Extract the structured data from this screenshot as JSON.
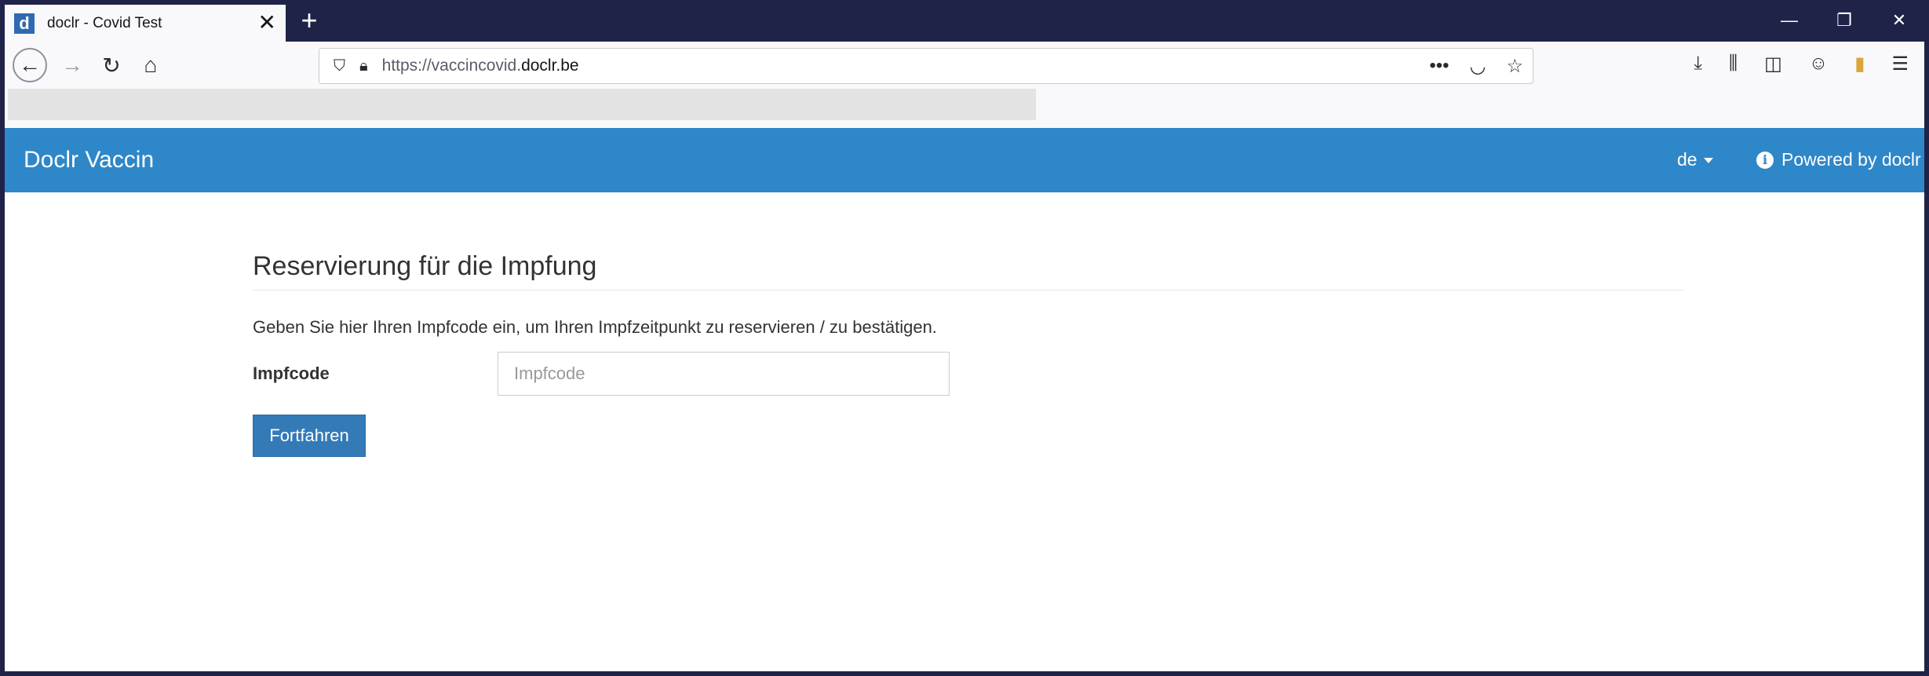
{
  "browser": {
    "tab_title": "doclr - Covid Test",
    "favicon_letter": "d",
    "url_prefix": "https://vaccincovid.",
    "url_domain": "doclr.be"
  },
  "site": {
    "brand": "Doclr Vaccin",
    "language": "de",
    "powered_by": "Powered by doclr",
    "accent_color": "#2e87c8"
  },
  "form": {
    "heading": "Reservierung für die Impfung",
    "description": "Geben Sie hier Ihren Impfcode ein, um Ihren Impfzeitpunkt zu reservieren / zu bestätigen.",
    "code_label": "Impfcode",
    "code_placeholder": "Impfcode",
    "code_value": "",
    "submit_label": "Fortfahren"
  }
}
